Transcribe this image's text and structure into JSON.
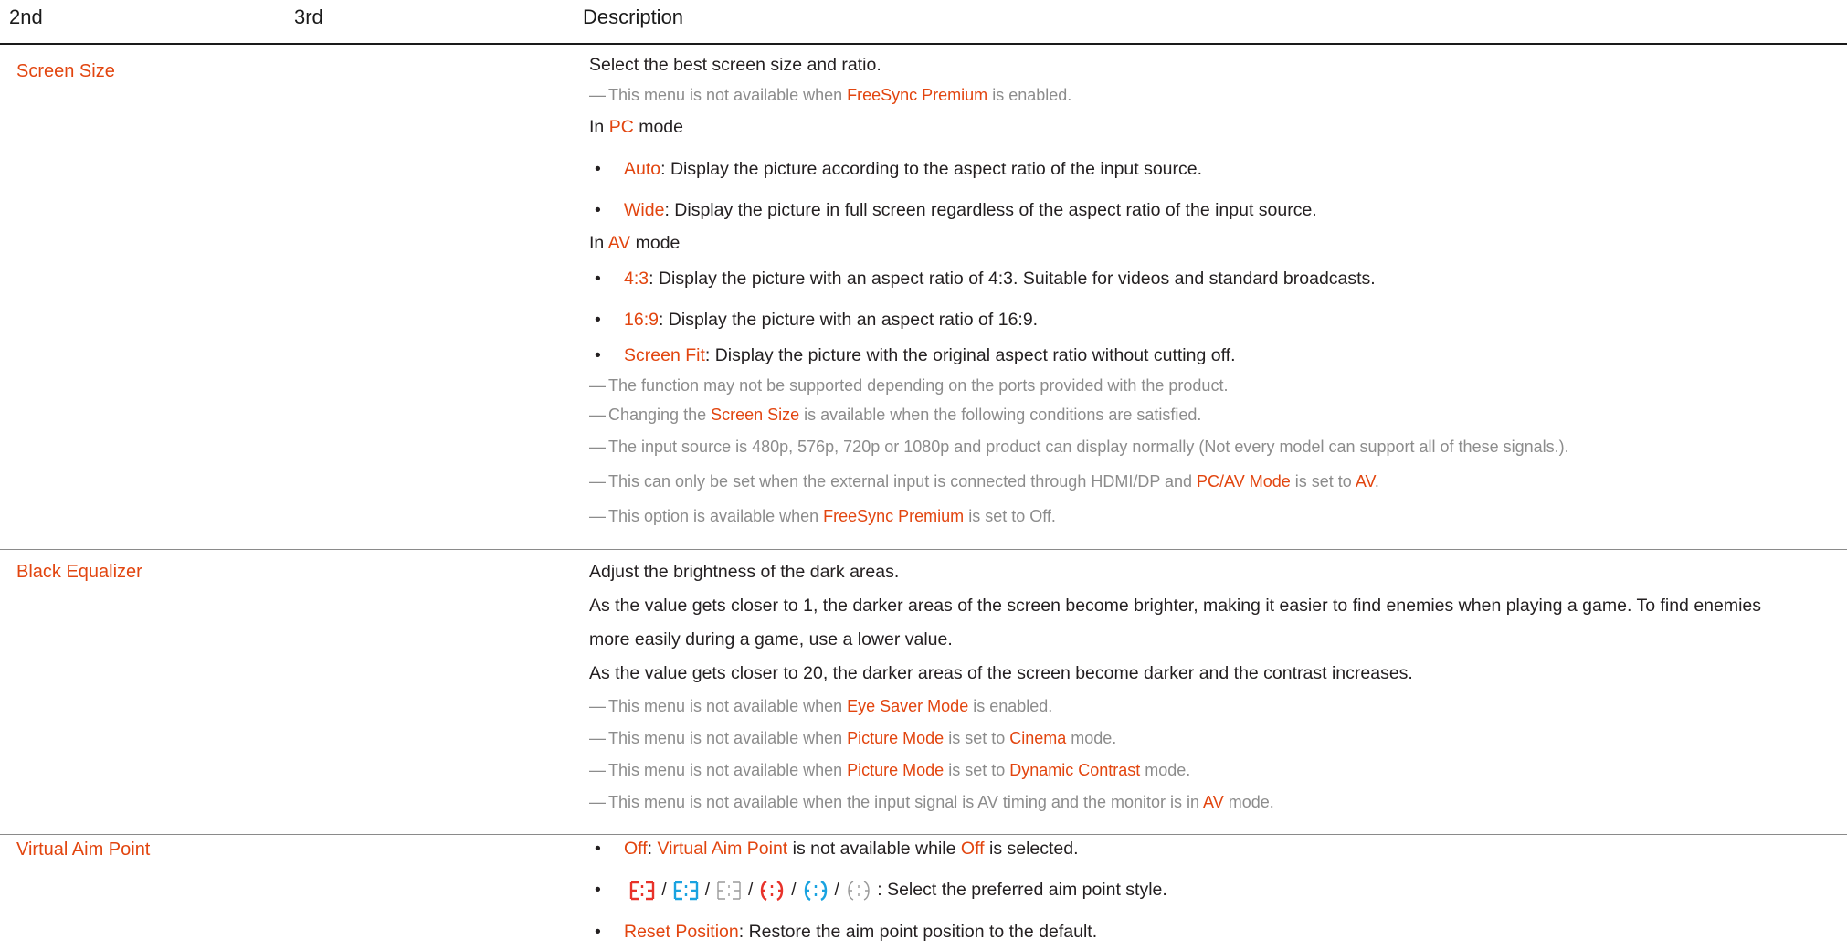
{
  "header": {
    "col2": "2nd",
    "col3": "3rd",
    "col_desc": "Description"
  },
  "screen_size": {
    "label": "Screen Size",
    "intro": "Select the best screen size and ratio.",
    "note1": {
      "a": "This menu is not available when ",
      "b": "FreeSync Premium",
      "c": " is enabled."
    },
    "pc_mode": {
      "a": "In ",
      "b": "PC",
      "c": " mode"
    },
    "auto": {
      "term": "Auto",
      "text": ": Display the picture according to the aspect ratio of the input source."
    },
    "wide": {
      "term": "Wide",
      "text": ": Display the picture in full screen regardless of the aspect ratio of the input source."
    },
    "av_mode": {
      "a": "In ",
      "b": "AV",
      "c": " mode"
    },
    "r43": {
      "term": "4:3",
      "text": ": Display the picture with an aspect ratio of 4:3. Suitable for videos and standard broadcasts."
    },
    "r169": {
      "term": "16:9",
      "text": ": Display the picture with an aspect ratio of 16:9."
    },
    "fit": {
      "term": "Screen Fit",
      "text": ": Display the picture with the original aspect ratio without cutting off."
    },
    "note2": "The function may not be supported depending on the ports provided with the product.",
    "note3": {
      "a": "Changing the ",
      "b": "Screen Size",
      "c": " is available when the following conditions are satisfied."
    },
    "note4": "The input source is 480p, 576p, 720p or 1080p and product can display normally (Not every model can support all of these signals.).",
    "note5": {
      "a": "This can only  be set when the external input is connected through HDMI/DP and ",
      "b": "PC/AV Mode",
      "c": " is set to ",
      "d": "AV",
      "e": "."
    },
    "note6": {
      "a": "This option is available when ",
      "b": "FreeSync Premium",
      "c": " is set to Off."
    }
  },
  "black_eq": {
    "label": "Black Equalizer",
    "intro": "Adjust the brightness of the dark areas.",
    "p1a": "As the value gets closer to 1, the darker areas of the screen become brighter, making it easier to find enemies when playing a game. To find enemies",
    "p1b": "more easily during a game, use a lower value.",
    "p2": "As the value gets closer to 20, the darker areas of the screen become darker and the contrast increases.",
    "note1": {
      "a": "This menu is not available when ",
      "b": "Eye Saver Mode",
      "c": " is enabled."
    },
    "note2": {
      "a": "This menu is not available when ",
      "b": "Picture Mode",
      "c": " is set to ",
      "d": "Cinema",
      "e": " mode."
    },
    "note3": {
      "a": "This menu is not available when ",
      "b": "Picture Mode",
      "c": " is set to ",
      "d": "Dynamic Contrast",
      "e": " mode."
    },
    "note4": {
      "a": "This menu is not available when the input signal is AV timing and the monitor is in ",
      "b": "AV",
      "c": " mode."
    }
  },
  "aim": {
    "label": "Virtual Aim Point",
    "off": {
      "term": "Off",
      "mid": ": ",
      "term2": "Virtual Aim Point",
      "mid2": " is not available while ",
      "term3": "Off",
      "end": " is selected."
    },
    "style_text": " : Select the preferred aim point style.",
    "sep": "/",
    "icons": [
      "aim-style-1-red",
      "aim-style-2-blue",
      "aim-style-3-gray",
      "aim-style-4-red",
      "aim-style-5-blue",
      "aim-style-6-gray"
    ],
    "colors": {
      "red": "#e8322a",
      "blue": "#1aa3e0",
      "gray": "#9a9a9a"
    },
    "reset": {
      "term": "Reset Position",
      "text": ": Restore the aim point position to the default."
    }
  },
  "bullet": "•",
  "dash": "―"
}
